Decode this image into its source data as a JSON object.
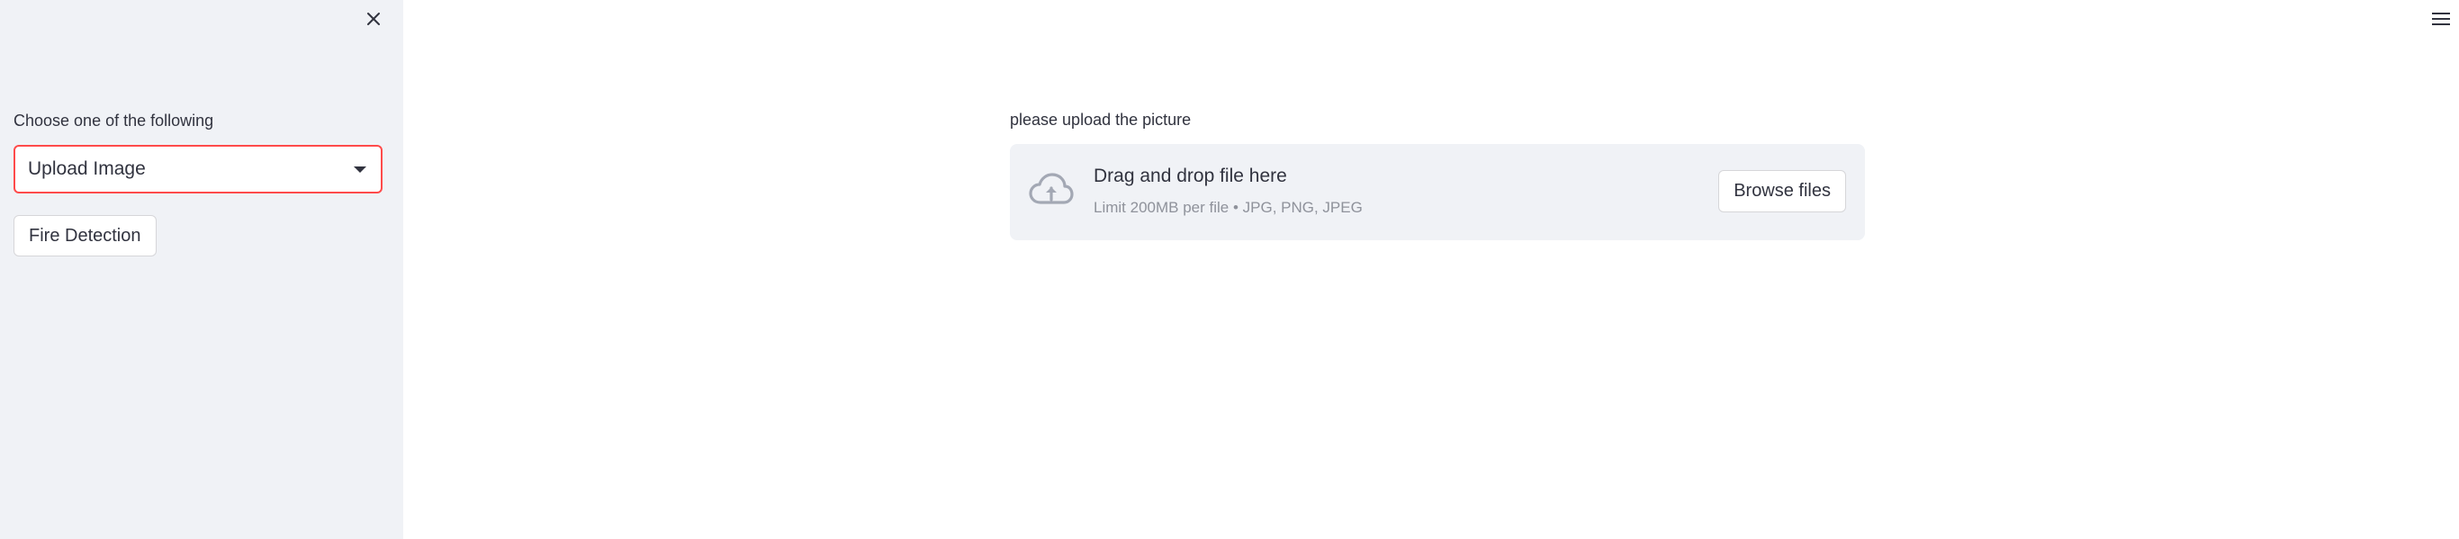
{
  "sidebar": {
    "close_icon": "close-icon",
    "select_label": "Choose one of the following",
    "select_value": "Upload Image",
    "select_accent_color": "#ff4b4b",
    "button_label": "Fire Detection",
    "background_color": "#f0f2f6"
  },
  "header": {
    "menu_icon": "hamburger-menu-icon"
  },
  "main": {
    "uploader_label": "please upload the picture",
    "dropzone": {
      "icon": "cloud-upload-icon",
      "title": "Drag and drop file here",
      "subtitle": "Limit 200MB per file • JPG, PNG, JPEG",
      "browse_label": "Browse files"
    }
  }
}
